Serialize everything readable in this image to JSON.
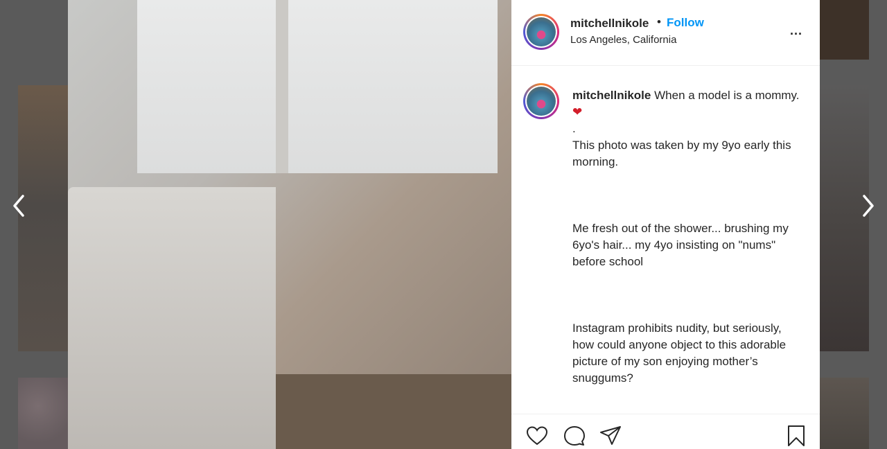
{
  "feed": {
    "nav_prev_icon": "chevron-left-icon",
    "nav_next_icon": "chevron-right-icon"
  },
  "post": {
    "author": "mitchellnikole",
    "separator": "•",
    "follow_label": "Follow",
    "location": "Los Angeles, California",
    "more_icon_label": "...",
    "caption_line1": "When a model is a mommy.",
    "caption_emoji": "❤",
    "caption_body": "\n.\nThis photo was taken by my 9yo early this morning.\n\n\n\nMe fresh out of the shower... brushing my 6yo's hair... my 4yo insisting on \"nums\" before school\n\n\n\nInstagram prohibits nudity, but seriously, how could anyone object to this adorable picture of my son enjoying mother’s snuggums?"
  },
  "actions": {
    "like_icon": "heart-icon",
    "comment_icon": "comment-icon",
    "share_icon": "send-icon",
    "save_icon": "bookmark-icon"
  },
  "colors": {
    "accent": "#0095f6",
    "text": "#262626",
    "heart": "#d31e2a"
  }
}
